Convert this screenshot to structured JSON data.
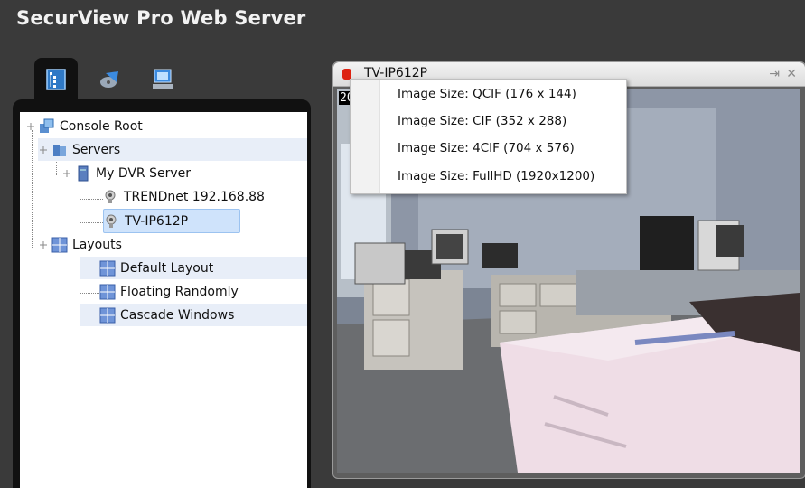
{
  "app": {
    "title": "SecurView Pro Web Server"
  },
  "left_tabs": [
    {
      "name": "console-tree"
    },
    {
      "name": "playback"
    },
    {
      "name": "computer"
    }
  ],
  "tree": {
    "console_root": "Console Root",
    "servers": "Servers",
    "my_dvr_server": "My DVR Server",
    "camera_1": "TRENDnet 192.168.88",
    "camera_2": "TV-IP612P",
    "layouts": "Layouts",
    "layout_1": "Default Layout",
    "layout_2": "Floating Randomly",
    "layout_3": "Cascade Windows"
  },
  "video_window": {
    "title": "TV-IP612P",
    "timestamp": "20",
    "pin_glyph": "⇥",
    "close_glyph": "✕"
  },
  "context_menu": {
    "items": [
      "Image Size: QCIF (176 x 144)",
      "Image Size: CIF (352 x 288)",
      "Image Size: 4CIF (704 x 576)",
      "Image Size: FullHD (1920x1200)"
    ]
  },
  "colors": {
    "background": "#3a3a3a",
    "panel": "#111111",
    "tree_band": "#e8eef8",
    "selection": "#cfe3fb",
    "record_indicator": "#dd2211"
  }
}
